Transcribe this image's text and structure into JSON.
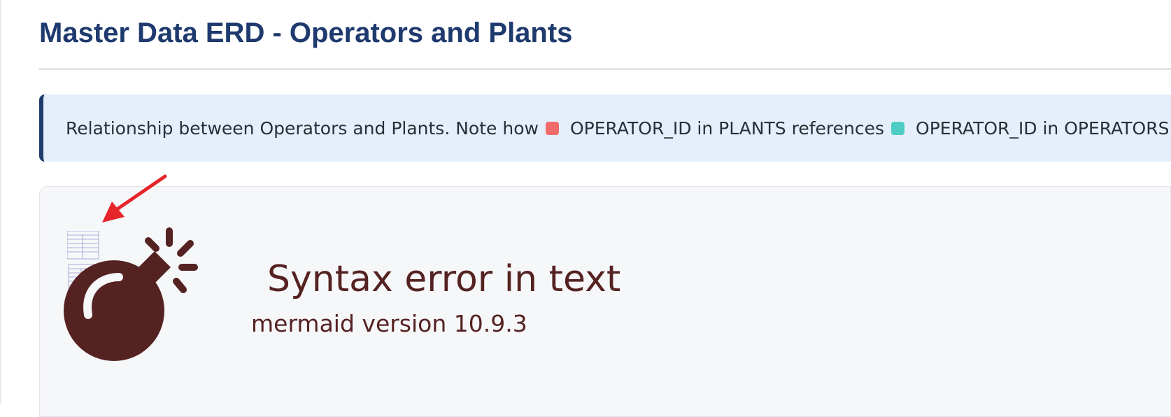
{
  "page": {
    "title": "Master Data ERD - Operators and Plants"
  },
  "info": {
    "text_before": "Relationship between Operators and Plants. Note how",
    "fk_label": "OPERATOR_ID in PLANTS references",
    "pk_label": "OPERATOR_ID in OPERATORS.",
    "fk_color": "#f26b6b",
    "pk_color": "#4ecdc4"
  },
  "mermaid_error": {
    "message": "Syntax error in text",
    "version": "mermaid version 10.9.3",
    "icon": "bomb-icon",
    "color": "#552222"
  },
  "annotation": {
    "icon": "arrow-icon",
    "color": "#e5252a"
  }
}
